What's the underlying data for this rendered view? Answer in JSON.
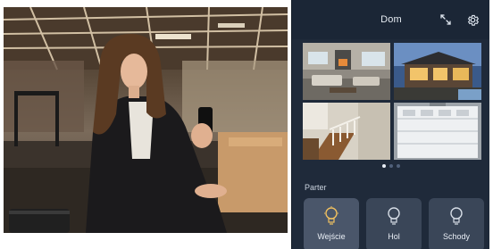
{
  "app": {
    "title": "Dom",
    "section": "Parter",
    "accent_color": "#f0c060",
    "background_color": "#1f2a3a",
    "header_icons": [
      "expand-icon",
      "gear-icon"
    ],
    "carousel": {
      "pages": 3,
      "active_page": 1
    },
    "cameras": [
      {
        "name": "living-room-camera"
      },
      {
        "name": "house-exterior-camera"
      },
      {
        "name": "staircase-camera"
      },
      {
        "name": "garage-door-camera"
      }
    ],
    "scenes": [
      {
        "label": "Wejście",
        "icon": "lightbulb-icon",
        "active": true
      },
      {
        "label": "Hol",
        "icon": "lightbulb-icon",
        "active": false
      },
      {
        "label": "Schody",
        "icon": "lightbulb-icon",
        "active": false
      }
    ]
  }
}
